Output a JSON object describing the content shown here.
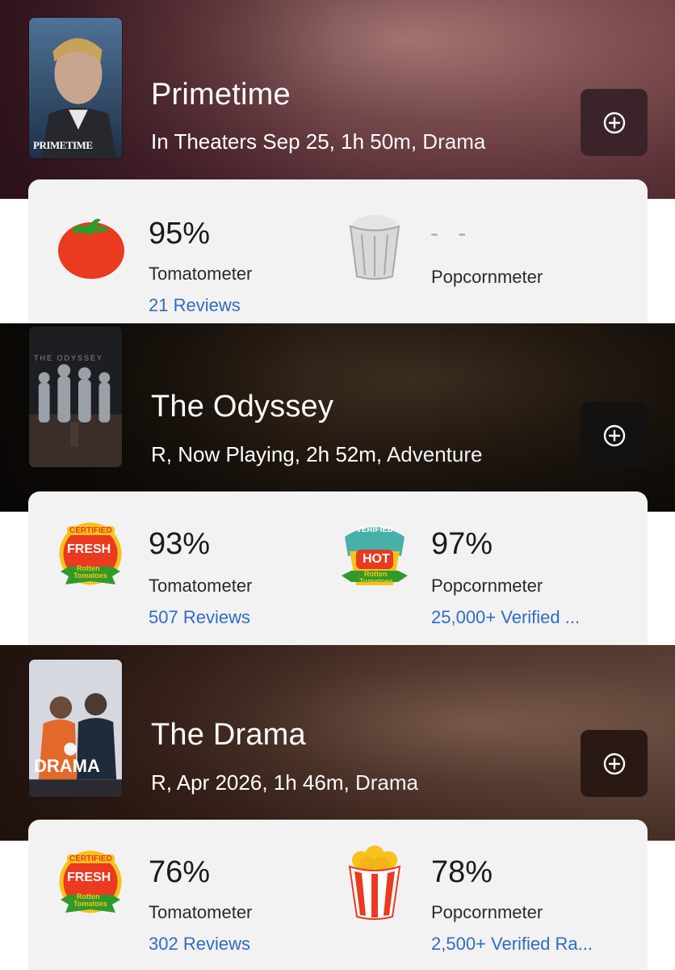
{
  "movies": [
    {
      "title": "Primetime",
      "meta_main": "In Theaters Sep 25, 1h 50m,",
      "genre": "Drama",
      "poster_text": "PRIMETIME",
      "tomatometer": {
        "value": "95%",
        "label": "Tomatometer",
        "reviews": "21 Reviews",
        "icon": "fresh-tomato-icon"
      },
      "popcornmeter": {
        "value": "- -",
        "label": "Popcornmeter",
        "reviews": "",
        "icon": "empty-popcorn-icon"
      }
    },
    {
      "title": "The Odyssey",
      "meta_main": "R, Now Playing, 2h 52m,",
      "genre": "Adventure",
      "poster_text": "THE ODYSSEY",
      "tomatometer": {
        "value": "93%",
        "label": "Tomatometer",
        "reviews": "507 Reviews",
        "icon": "certified-fresh-icon"
      },
      "popcornmeter": {
        "value": "97%",
        "label": "Popcornmeter",
        "reviews": "25,000+ Verified ...",
        "icon": "verified-hot-icon"
      }
    },
    {
      "title": "The Drama",
      "meta_main": "R, Apr 2026, 1h 46m,",
      "genre": "Drama",
      "poster_text": "DRAMA",
      "tomatometer": {
        "value": "76%",
        "label": "Tomatometer",
        "reviews": "302 Reviews",
        "icon": "certified-fresh-icon"
      },
      "popcornmeter": {
        "value": "78%",
        "label": "Popcornmeter",
        "reviews": "2,500+ Verified Ra...",
        "icon": "full-popcorn-icon"
      }
    }
  ],
  "badges": {
    "certified": "CERTIFIED",
    "fresh": "FRESH",
    "rotten": "Rotten",
    "tomatoes": "Tomatoes",
    "verified": "VERIFIED",
    "hot": "HOT"
  },
  "colors": {
    "link": "#2f6cc4",
    "card_bg": "#f2f2f3",
    "tomato_red": "#e8321c",
    "popcorn_yellow": "#f7c21b"
  }
}
